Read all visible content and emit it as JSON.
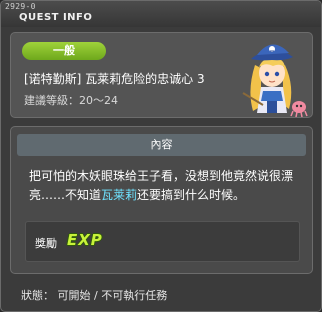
{
  "window": {
    "quest_id": "2929-0",
    "title": "QUEST INFO"
  },
  "header": {
    "category": "一般",
    "quest_name": "[诺特勤斯] 瓦莱莉危险的忠诚心 3",
    "level_requirement": "建議等級：20～24"
  },
  "content": {
    "section_title": "內容",
    "description_part1": "把可怕的木妖眼珠给王子看，没想到他竟然说很漂亮……不知道",
    "description_highlight": "瓦莱莉",
    "description_part2": "还要搞到什么时候。",
    "reward_label": "獎勵",
    "reward_icon_text": "EXP"
  },
  "status": {
    "text": "狀態： 可開始 / 不可執行任務"
  },
  "colors": {
    "badge_green": "#8cc832",
    "highlight_cyan": "#6fe3ff",
    "exp_green": "#c8f23a"
  }
}
